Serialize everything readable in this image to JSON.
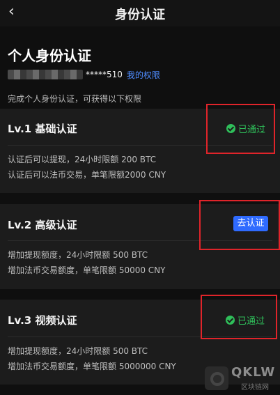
{
  "header": {
    "back_icon": "chevron-left-icon",
    "title": "身份认证"
  },
  "hero": {
    "title": "个人身份认证",
    "masked_account": "*****510",
    "permission_link": "我的权限",
    "hint": "完成个人身份认证，可获得以下权限"
  },
  "levels": [
    {
      "title": "Lv.1 基础认证",
      "status": "已通过",
      "status_icon": "check-circle-icon",
      "lines": [
        "认证后可以提现，24小时限额 200 BTC",
        "认证后可以法币交易，单笔限额2000 CNY"
      ]
    },
    {
      "title": "Lv.2 高级认证",
      "action": "去认证",
      "lines": [
        "增加提现额度，24小时限额 500 BTC",
        "增加法币交易额度，单笔限额 50000 CNY"
      ]
    },
    {
      "title": "Lv.3 视频认证",
      "status": "已通过",
      "status_icon": "check-circle-icon",
      "lines": [
        "增加提现额度，24小时限额 500 BTC",
        "增加法币交易额度，单笔限额 5000000 CNY"
      ]
    }
  ],
  "watermark": {
    "brand": "QKLW",
    "sub": "区块链网"
  },
  "colors": {
    "background": "#0f0f0f",
    "card": "#1c1c1c",
    "success": "#2fbf5a",
    "accent": "#2f6bff",
    "link": "#4f8cff",
    "highlight": "#e0242a"
  }
}
